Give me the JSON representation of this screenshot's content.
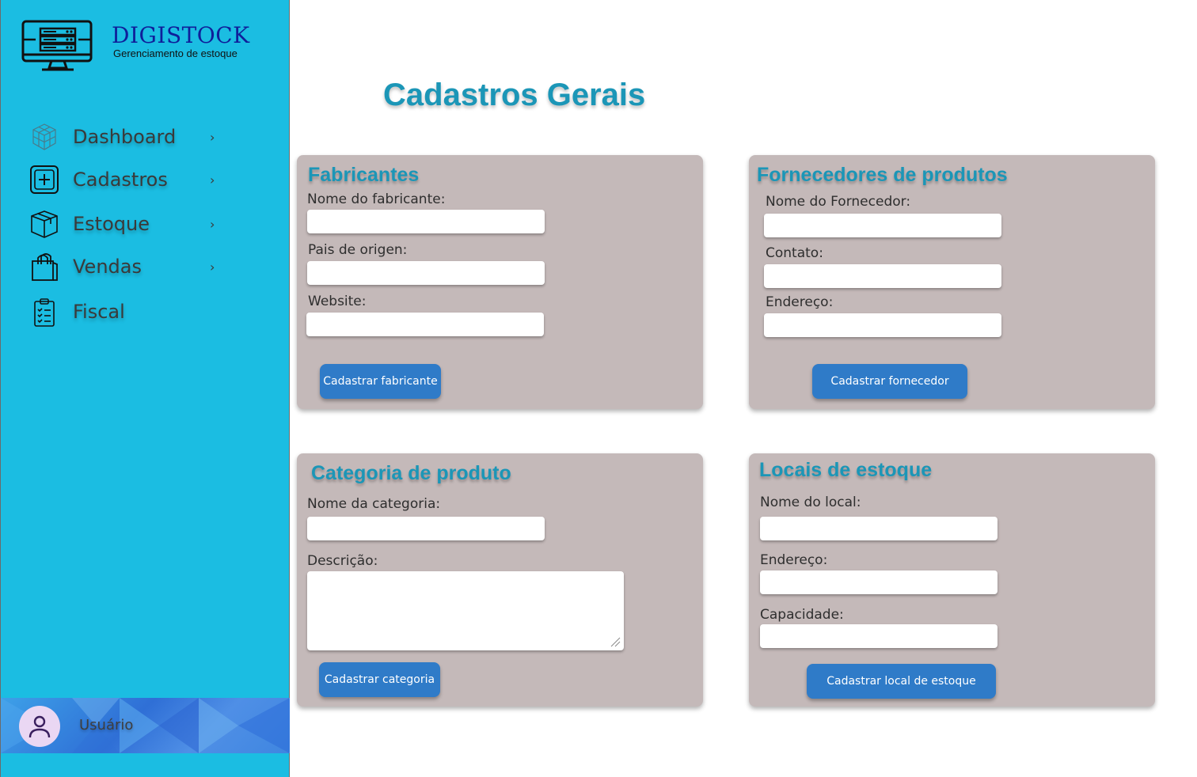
{
  "app": {
    "brand": "DIGISTOCK",
    "tagline": "Gerenciamento de estoque"
  },
  "sidebar": {
    "items": [
      {
        "label": "Dashboard",
        "icon": "cubes-icon",
        "has_chevron": true
      },
      {
        "label": "Cadastros",
        "icon": "plus-box-icon",
        "has_chevron": true
      },
      {
        "label": "Estoque",
        "icon": "box-icon",
        "has_chevron": true
      },
      {
        "label": "Vendas",
        "icon": "shopping-bag-icon",
        "has_chevron": true
      },
      {
        "label": "Fiscal",
        "icon": "clipboard-icon",
        "has_chevron": false
      }
    ],
    "chevron": "›",
    "user": {
      "name": "Usuário",
      "icon": "user-icon"
    }
  },
  "main": {
    "title": "Cadastros Gerais",
    "fabricantes": {
      "title": "Fabricantes",
      "fields": [
        "Nome do fabricante:",
        "Pais de origen:",
        "Website:"
      ],
      "button": "Cadastrar fabricante"
    },
    "fornecedores": {
      "title": "Fornecedores de produtos",
      "fields": [
        "Nome do Fornecedor:",
        "Contato:",
        "Endereço:"
      ],
      "button": "Cadastrar fornecedor"
    },
    "categoria": {
      "title": "Categoria de produto",
      "fields": [
        "Nome da categoria:",
        "Descrição:"
      ],
      "button": "Cadastrar categoria"
    },
    "locais": {
      "title": "Locais de estoque",
      "fields": [
        "Nome do local:",
        "Endereço:",
        "Capacidade:"
      ],
      "button": "Cadastrar local de estoque"
    }
  },
  "colors": {
    "sidebar_bg": "#1bbde2",
    "card_bg": "#c4b9b9",
    "accent_title": "#1b96b7",
    "button_bg": "#2f7bc8",
    "brand_text": "#0f1f9a"
  }
}
